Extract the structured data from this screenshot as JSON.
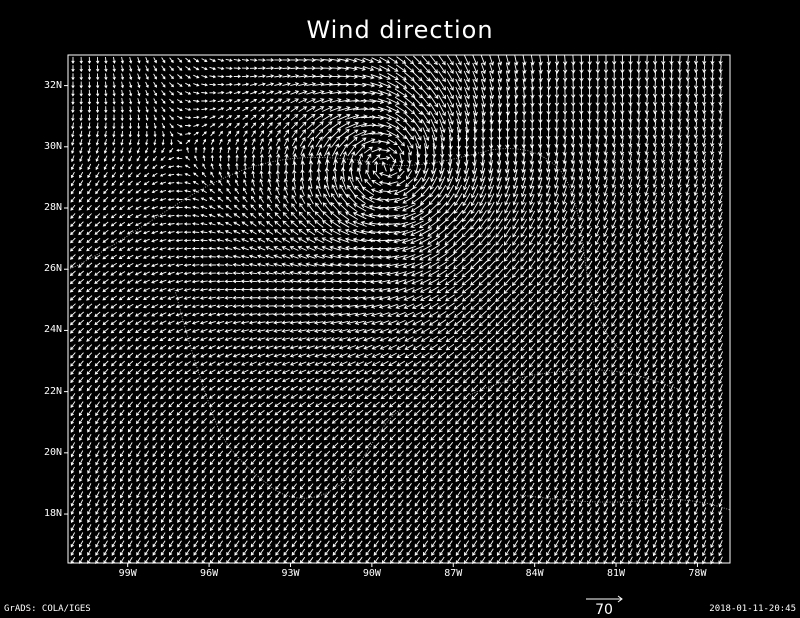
{
  "title": "Wind direction",
  "footer": {
    "left": "GrADS: COLA/IGES",
    "right": "2018-01-11-20:45"
  },
  "reference_vector": {
    "label": "70"
  },
  "y_ticks": [
    {
      "lat": 32,
      "label": "32N"
    },
    {
      "lat": 30,
      "label": "30N"
    },
    {
      "lat": 28,
      "label": "28N"
    },
    {
      "lat": 26,
      "label": "26N"
    },
    {
      "lat": 24,
      "label": "24N"
    },
    {
      "lat": 22,
      "label": "22N"
    },
    {
      "lat": 20,
      "label": "20N"
    },
    {
      "lat": 18,
      "label": "18N"
    }
  ],
  "x_ticks": [
    {
      "lon": -99,
      "label": "99W"
    },
    {
      "lon": -96,
      "label": "96W"
    },
    {
      "lon": -93,
      "label": "93W"
    },
    {
      "lon": -90,
      "label": "90W"
    },
    {
      "lon": -87,
      "label": "87W"
    },
    {
      "lon": -84,
      "label": "84W"
    },
    {
      "lon": -81,
      "label": "81W"
    },
    {
      "lon": -78,
      "label": "78W"
    }
  ],
  "map_extent": {
    "lon_min": -101.2,
    "lon_max": -76.8,
    "lat_min": 16.4,
    "lat_max": 33.0
  },
  "vortex_center": {
    "lon": -89.4,
    "lat": 29.4
  },
  "colors": {
    "background": "#000000",
    "foreground": "#ffffff"
  }
}
